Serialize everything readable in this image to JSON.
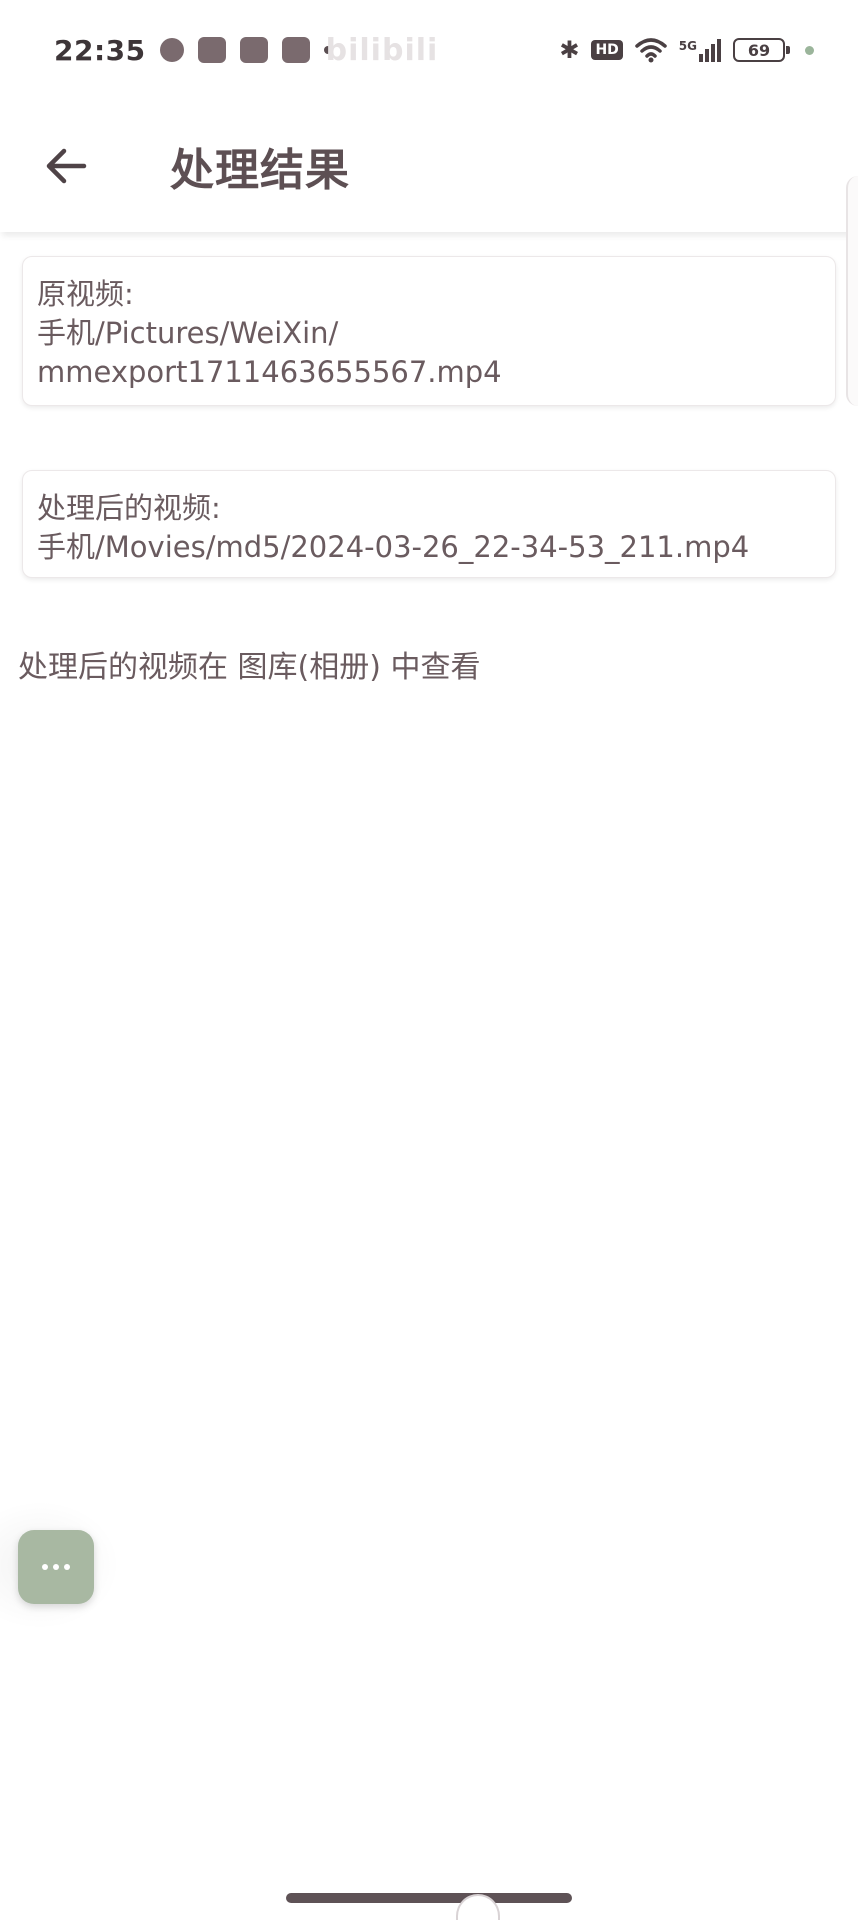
{
  "status_bar": {
    "time": "22:35",
    "watermark": "bilibili",
    "battery_level": "69",
    "hd_label": "HD",
    "network_label": "5G"
  },
  "app_bar": {
    "title": "处理结果"
  },
  "original_video": {
    "label": "原视频:",
    "path_line1": "手机/Pictures/WeiXin/",
    "path_line2": "mmexport1711463655567.mp4"
  },
  "processed_video": {
    "label": "处理后的视频:",
    "path": "手机/Movies/md5/2024-03-26_22-34-53_211.mp4"
  },
  "info_text": "处理后的视频在 图库(相册) 中查看",
  "colors": {
    "fab": "#a8b8a2",
    "text": "#6a5b5f",
    "title": "#5d4f53"
  }
}
